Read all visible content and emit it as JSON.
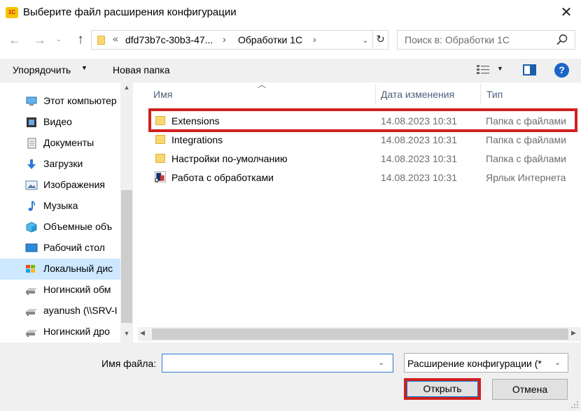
{
  "window": {
    "title": "Выберите файл расширения конфигурации",
    "app_icon_text": "1С",
    "close_symbol": "✕"
  },
  "address": {
    "crumbs": [
      "dfd73b7c-30b3-47...",
      "Обработки 1С"
    ],
    "overflow_chevron": "«",
    "separator": "›"
  },
  "search": {
    "placeholder": "Поиск в: Обработки 1С"
  },
  "toolbar": {
    "organize_label": "Упорядочить",
    "new_folder_label": "Новая папка",
    "help_label": "?"
  },
  "nav_pane": {
    "items": [
      {
        "label": "Этот компьютер",
        "icon": "computer-icon"
      },
      {
        "label": "Видео",
        "icon": "video-icon"
      },
      {
        "label": "Документы",
        "icon": "documents-icon"
      },
      {
        "label": "Загрузки",
        "icon": "downloads-icon"
      },
      {
        "label": "Изображения",
        "icon": "pictures-icon"
      },
      {
        "label": "Музыка",
        "icon": "music-icon"
      },
      {
        "label": "Объемные объ",
        "icon": "3d-objects-icon"
      },
      {
        "label": "Рабочий стол",
        "icon": "desktop-icon"
      },
      {
        "label": "Локальный дис",
        "icon": "local-disk-icon",
        "selected": true
      },
      {
        "label": "Ногинский обм",
        "icon": "network-drive-icon"
      },
      {
        "label": "ayanush (\\\\SRV-I",
        "icon": "network-drive-icon"
      },
      {
        "label": "Ногинский дро",
        "icon": "network-drive-icon"
      }
    ]
  },
  "file_list": {
    "columns": [
      "Имя",
      "Дата изменения",
      "Тип"
    ],
    "rows": [
      {
        "name": "Extensions",
        "date": "14.08.2023 10:31",
        "type": "Папка с файлами",
        "icon": "folder-icon",
        "highlighted": true
      },
      {
        "name": "Integrations",
        "date": "14.08.2023 10:31",
        "type": "Папка с файлами",
        "icon": "folder-icon"
      },
      {
        "name": "Настройки по-умолчанию",
        "date": "14.08.2023 10:31",
        "type": "Папка с файлами",
        "icon": "folder-icon"
      },
      {
        "name": "Работа с обработками",
        "date": "14.08.2023 10:31",
        "type": "Ярлык Интернета",
        "icon": "internet-shortcut-icon"
      }
    ]
  },
  "footer": {
    "filename_label": "Имя файла:",
    "filename_value": "",
    "filter_value": "Расширение конфигурации (*",
    "open_label": "Открыть",
    "cancel_label": "Отмена"
  },
  "colors": {
    "highlight_border": "#d0201f",
    "selected_nav_bg": "#cde8ff",
    "toolbar_bg": "#f0f0f0",
    "folder_yellow": "#f8d775"
  }
}
